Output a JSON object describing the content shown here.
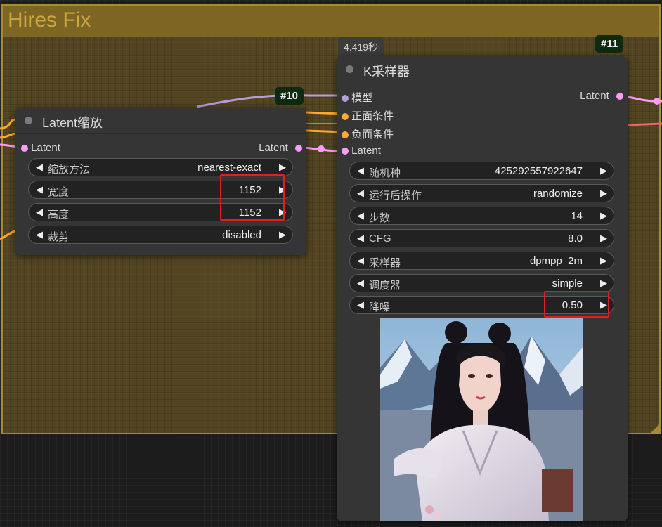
{
  "group": {
    "title": "Hires Fix"
  },
  "latent_upscale_node": {
    "id_badge": "#10",
    "title": "Latent缩放",
    "input_label": "Latent",
    "output_label": "Latent",
    "widgets": [
      {
        "label": "缩放方法",
        "value": "nearest-exact"
      },
      {
        "label": "宽度",
        "value": "1152"
      },
      {
        "label": "高度",
        "value": "1152"
      },
      {
        "label": "裁剪",
        "value": "disabled"
      }
    ]
  },
  "ksampler_node": {
    "id_badge": "#11",
    "exec_time": "4.419秒",
    "title": "K采样器",
    "inputs": [
      "模型",
      "正面条件",
      "负面条件",
      "Latent"
    ],
    "output_label": "Latent",
    "widgets": [
      {
        "label": "随机种",
        "value": "425292557922647"
      },
      {
        "label": "运行后操作",
        "value": "randomize"
      },
      {
        "label": "步数",
        "value": "14"
      },
      {
        "label": "CFG",
        "value": "8.0"
      },
      {
        "label": "采样器",
        "value": "dpmpp_2m"
      },
      {
        "label": "调度器",
        "value": "simple"
      },
      {
        "label": "降噪",
        "value": "0.50"
      }
    ]
  },
  "icons": {
    "left_arrow": "◀",
    "right_arrow": "▶"
  },
  "colors": {
    "group_fill": "#7d6624",
    "group_title": "#c9a642",
    "node_bg": "#353535",
    "badge_bg": "#0f2a12",
    "highlight": "#e02020",
    "model_link": "#b39ddb",
    "conditioning_link": "#ffa931",
    "latent_link": "#ff9cf9"
  }
}
